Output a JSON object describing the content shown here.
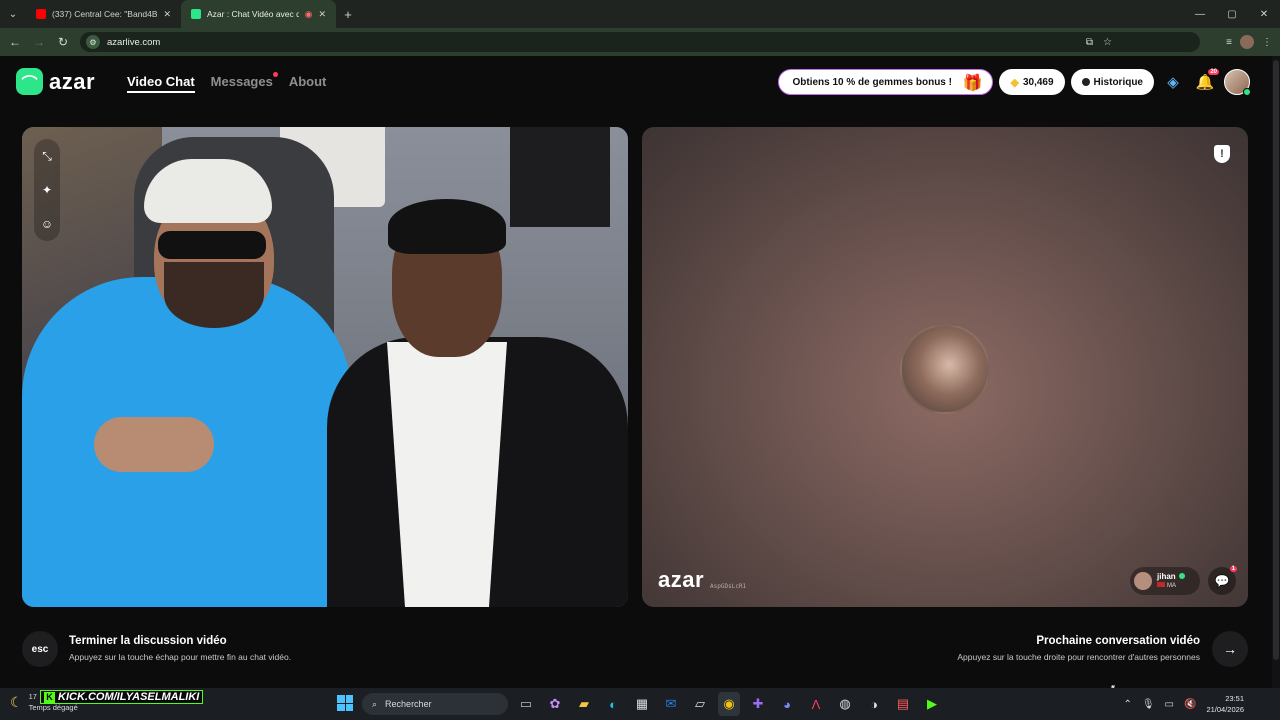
{
  "browser": {
    "tabs": [
      {
        "title": "(337) Central Cee: \"Band4Band\"",
        "active": false,
        "favicon_color": "#ff0000"
      },
      {
        "title": "Azar : Chat Vidéo avec de nouve",
        "active": true,
        "favicon_color": "#2ee68a"
      }
    ],
    "new_tab": "+",
    "url": "azarlive.com",
    "window_controls": {
      "minimize": "—",
      "maximize": "▢",
      "close": "✕"
    }
  },
  "app": {
    "logo": "azar",
    "nav": {
      "video_chat": "Video Chat",
      "messages": "Messages",
      "about": "About"
    },
    "promo": "Obtiens 10 % de gemmes bonus !",
    "gems": "30,469",
    "history": "Historique",
    "notification_count": "20",
    "colors": {
      "brand": "#2ee68a",
      "promo_border": "#c86cf0",
      "badge": "#ff3b5c"
    }
  },
  "partner": {
    "watermark": "azar",
    "session_id": "AspGDsLcR1",
    "name": "jihan",
    "country": "MA",
    "chat_badge": "1"
  },
  "controls": {
    "esc_key": "esc",
    "end_title": "Terminer la discussion vidéo",
    "end_sub": "Appuyez sur la touche échap pour mettre fin au chat vidéo.",
    "next_title": "Prochaine conversation vidéo",
    "next_sub": "Appuyez sur la touche droite pour rencontrer d'autres personnes"
  },
  "taskbar": {
    "weather_temp": "17",
    "weather_desc": "Temps dégagé",
    "kick_text": "KICK.COM/ILYASELMALIKI",
    "kick_logo": "K",
    "search_placeholder": "Rechercher",
    "time": "23:51",
    "date": "21/04/2026"
  }
}
